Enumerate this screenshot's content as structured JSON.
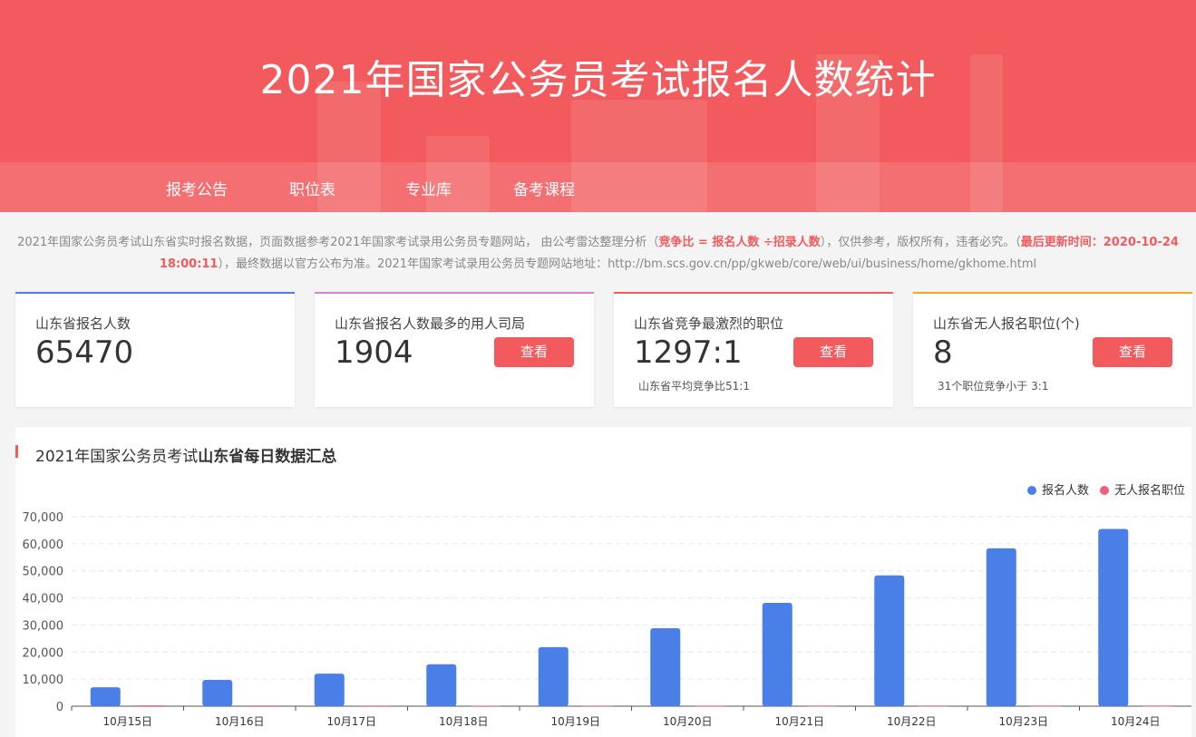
{
  "header": {
    "title": "2021年国家公务员考试报名人数统计"
  },
  "nav": {
    "items": [
      "报考公告",
      "职位表",
      "专业库",
      "备考课程"
    ]
  },
  "notice": {
    "part1": "2021年国家公务员考试山东省实时报名数据，页面数据参考2021年国家考试录用公务员专题网站， 由公考雷达整理分析（",
    "ratio_formula": "竞争比 = 报名人数 ÷招录人数",
    "part2": "），仅供参考，版权所有，违者必究。（",
    "update_time": "最后更新时间：2020-10-24 18:00:11",
    "part3": "），最终数据以官方公布为准。2021年国家考试录用公务员专题网站地址：http://bm.scs.gov.cn/pp/gkweb/core/web/ui/business/home/gkhome.html"
  },
  "cards": [
    {
      "label": "山东省报名人数",
      "value": "65470",
      "accent": "#4a7fe8"
    },
    {
      "label": "山东省报名人数最多的用人司局",
      "value": "1904",
      "button": "查看",
      "accent": "#e07de0"
    },
    {
      "label": "山东省竞争最激烈的职位",
      "value": "1297:1",
      "button": "查看",
      "sub": "山东省平均竞争比51:1",
      "accent": "#f25a5d"
    },
    {
      "label": "山东省无人报名职位(个)",
      "value": "8",
      "button": "查看",
      "sub": "31个职位竞争小于 3:1",
      "accent": "#f5a623"
    }
  ],
  "panel": {
    "title_prefix": "2021年国家公务员考试",
    "title_bold": "山东省每日数据汇总"
  },
  "colors": {
    "brand": "#f25a5d",
    "series_registrations": "#4a7fe8",
    "series_no_applicant": "#f0607a"
  },
  "chart_data": {
    "type": "bar",
    "categories": [
      "10月15日",
      "10月16日",
      "10月17日",
      "10月18日",
      "10月19日",
      "10月20日",
      "10月21日",
      "10月22日",
      "10月23日",
      "10月24日"
    ],
    "series": [
      {
        "name": "报名人数",
        "values": [
          7000,
          9700,
          12000,
          15500,
          21800,
          28800,
          38200,
          48300,
          58300,
          65470
        ]
      },
      {
        "name": "无人报名职位",
        "values": [
          300,
          250,
          200,
          150,
          100,
          80,
          50,
          30,
          20,
          8
        ]
      }
    ],
    "y_ticks": [
      "0",
      "10,000",
      "20,000",
      "30,000",
      "40,000",
      "50,000",
      "60,000",
      "70,000"
    ],
    "ylim": [
      0,
      70000
    ],
    "grid": true,
    "legend_position": "top-right"
  }
}
